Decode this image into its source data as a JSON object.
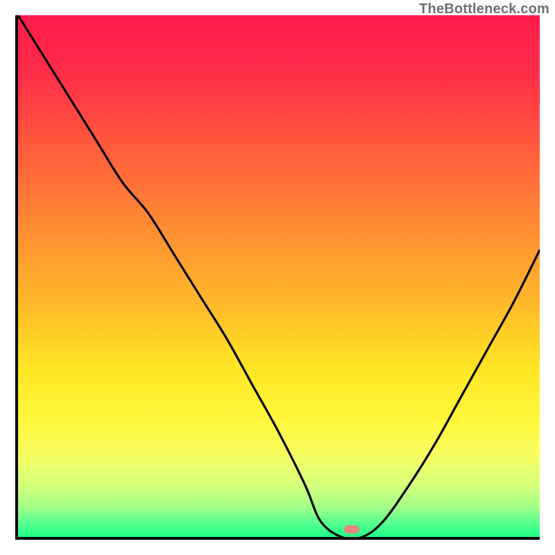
{
  "watermark": "TheBottleneck.com",
  "marker": {
    "x_fraction": 0.64,
    "y_fraction": 0.985,
    "color": "#e38a80"
  },
  "gradient_stops": [
    {
      "offset": 0.0,
      "color": "#ff1a4d"
    },
    {
      "offset": 0.12,
      "color": "#ff2f48"
    },
    {
      "offset": 0.25,
      "color": "#ff5a3d"
    },
    {
      "offset": 0.4,
      "color": "#ff8a33"
    },
    {
      "offset": 0.55,
      "color": "#ffb82a"
    },
    {
      "offset": 0.68,
      "color": "#ffe724"
    },
    {
      "offset": 0.78,
      "color": "#fff83e"
    },
    {
      "offset": 0.85,
      "color": "#f5ff66"
    },
    {
      "offset": 0.9,
      "color": "#d4ff7a"
    },
    {
      "offset": 0.94,
      "color": "#a8ff88"
    },
    {
      "offset": 0.97,
      "color": "#5fff8f"
    },
    {
      "offset": 1.0,
      "color": "#1eff88"
    }
  ],
  "chart_data": {
    "type": "line",
    "title": "",
    "xlabel": "",
    "ylabel": "",
    "xlim": [
      0,
      1
    ],
    "ylim": [
      0,
      1
    ],
    "series": [
      {
        "name": "bottleneck-curve",
        "x": [
          0.0,
          0.05,
          0.1,
          0.15,
          0.2,
          0.25,
          0.3,
          0.35,
          0.4,
          0.45,
          0.5,
          0.55,
          0.58,
          0.62,
          0.66,
          0.7,
          0.75,
          0.8,
          0.85,
          0.9,
          0.95,
          1.0
        ],
        "y": [
          1.0,
          0.92,
          0.84,
          0.76,
          0.68,
          0.62,
          0.54,
          0.46,
          0.38,
          0.29,
          0.2,
          0.1,
          0.03,
          0.0,
          0.0,
          0.03,
          0.1,
          0.18,
          0.27,
          0.36,
          0.45,
          0.55
        ]
      }
    ],
    "marker_point": {
      "x": 0.64,
      "y": 0.015
    },
    "notes": "y fraction 0 = bottom (green), 1 = top (red). Curve starts top-left, descends to a flat minimum near x=0.60-0.68, then rises toward the right."
  }
}
